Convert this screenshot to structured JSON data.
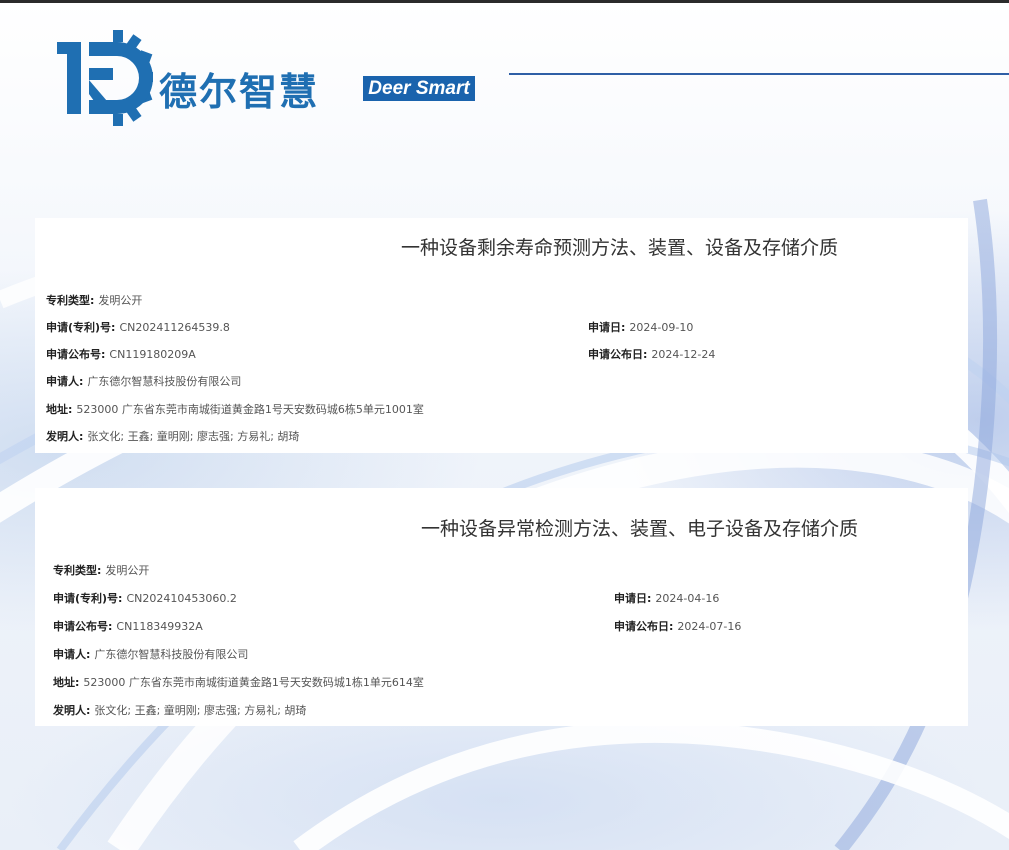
{
  "header": {
    "brand_cn": "德尔智慧",
    "brand_en": "Deer Smart"
  },
  "icons": {
    "logo": "ds-gear-logo-icon"
  },
  "colors": {
    "brand_blue": "#1f6fb2",
    "rule": "#2f5fa6"
  },
  "patents": [
    {
      "title": "一种设备剩余寿命预测方法、装置、设备及存储介质",
      "type_label": "专利类型:",
      "type": "发明公开",
      "app_no_label": "申请(专利)号:",
      "app_no": "CN202411264539.8",
      "app_date_label": "申请日:",
      "app_date": "2024-09-10",
      "pub_no_label": "申请公布号:",
      "pub_no": "CN119180209A",
      "pub_date_label": "申请公布日:",
      "pub_date": "2024-12-24",
      "applicant_label": "申请人:",
      "applicant": "广东德尔智慧科技股份有限公司",
      "address_label": "地址:",
      "address": "523000 广东省东莞市南城街道黄金路1号天安数码城6栋5单元1001室",
      "inventors_label": "发明人:",
      "inventors": "张文化; 王鑫; 童明刚; 廖志强; 方易礼; 胡琦"
    },
    {
      "title": "一种设备异常检测方法、装置、电子设备及存储介质",
      "type_label": "专利类型:",
      "type": "发明公开",
      "app_no_label": "申请(专利)号:",
      "app_no": "CN202410453060.2",
      "app_date_label": "申请日:",
      "app_date": "2024-04-16",
      "pub_no_label": "申请公布号:",
      "pub_no": "CN118349932A",
      "pub_date_label": "申请公布日:",
      "pub_date": "2024-07-16",
      "applicant_label": "申请人:",
      "applicant": "广东德尔智慧科技股份有限公司",
      "address_label": "地址:",
      "address": "523000 广东省东莞市南城街道黄金路1号天安数码城1栋1单元614室",
      "inventors_label": "发明人:",
      "inventors": "张文化; 王鑫; 童明刚; 廖志强; 方易礼; 胡琦"
    }
  ]
}
